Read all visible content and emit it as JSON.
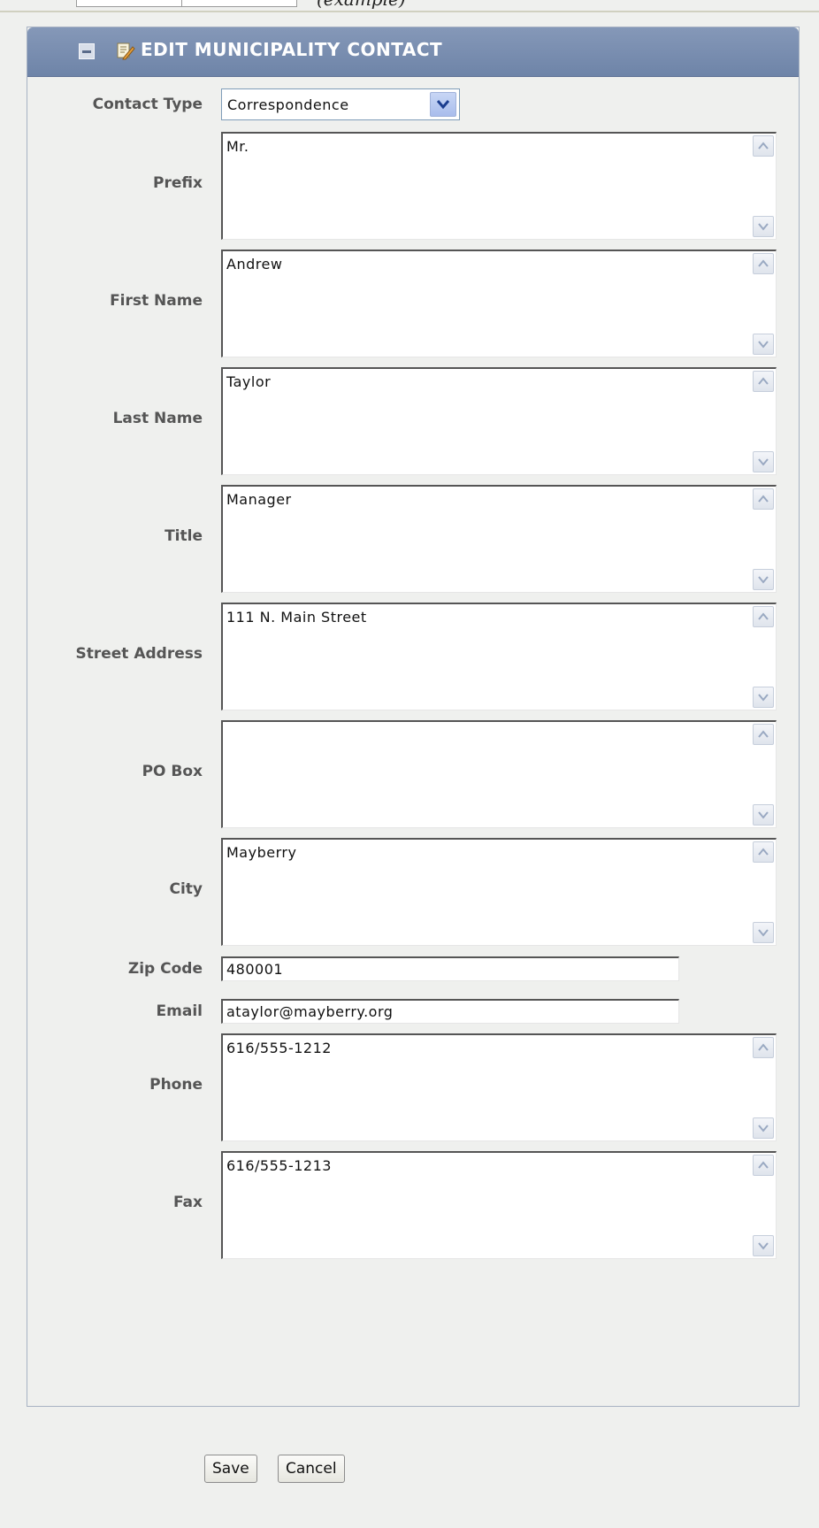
{
  "top": {
    "italic_text": "(example)"
  },
  "panel": {
    "title": "EDIT MUNICIPALITY CONTACT"
  },
  "form": {
    "contact_type": {
      "label": "Contact Type",
      "value": "Correspondence"
    },
    "prefix": {
      "label": "Prefix",
      "value": "Mr."
    },
    "first_name": {
      "label": "First Name",
      "value": "Andrew"
    },
    "last_name": {
      "label": "Last Name",
      "value": "Taylor"
    },
    "title": {
      "label": "Title",
      "value": "Manager"
    },
    "street_address": {
      "label": "Street Address",
      "value": "111 N. Main Street"
    },
    "po_box": {
      "label": "PO Box",
      "value": ""
    },
    "city": {
      "label": "City",
      "value": "Mayberry"
    },
    "zip_code": {
      "label": "Zip Code",
      "value": "480001"
    },
    "email": {
      "label": "Email",
      "value": "ataylor@mayberry.org"
    },
    "phone": {
      "label": "Phone",
      "value": "616/555-1212"
    },
    "fax": {
      "label": "Fax",
      "value": "616/555-1213"
    }
  },
  "buttons": {
    "save": "Save",
    "cancel": "Cancel"
  },
  "colors": {
    "header": "#7489ad",
    "background": "#eff0ee",
    "label": "#555555"
  },
  "icons": [
    "collapse-icon",
    "edit-icon",
    "scroll-up-icon",
    "scroll-down-icon",
    "dropdown-arrow-icon"
  ]
}
